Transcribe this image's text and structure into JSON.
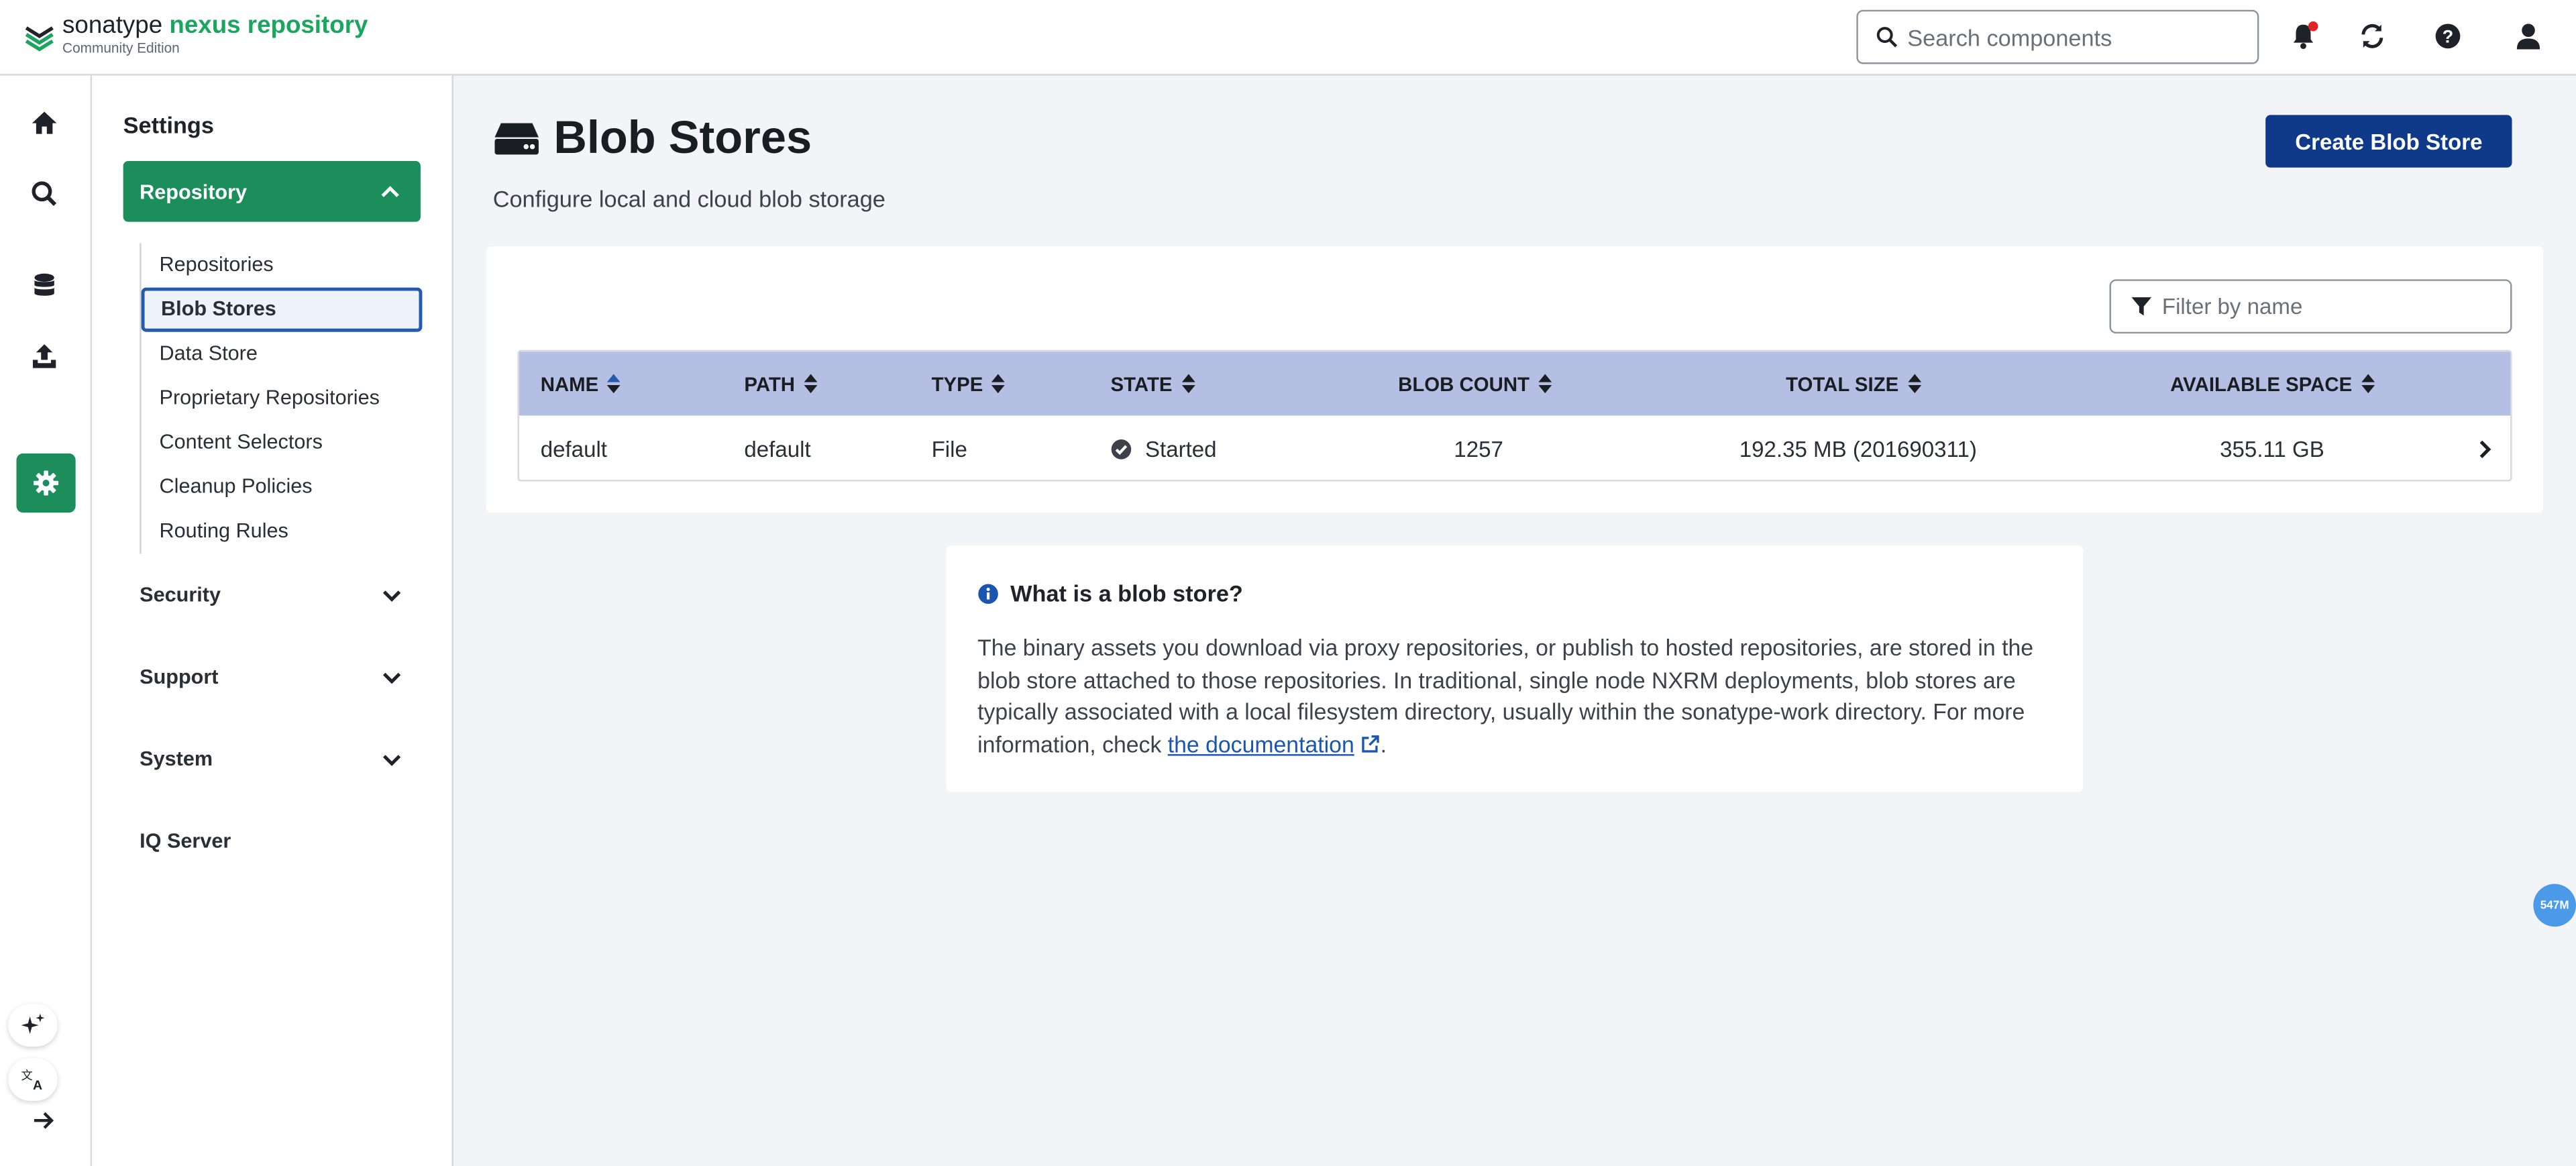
{
  "brand": {
    "name_part1": "sonatype",
    "name_part2": "nexus repository",
    "edition": "Community Edition",
    "accent_color": "#1ba65f"
  },
  "header": {
    "search": {
      "placeholder": "Search components",
      "value": ""
    },
    "icons": [
      "bell-icon",
      "refresh-icon",
      "help-icon",
      "user-icon"
    ]
  },
  "rail": {
    "items": [
      "home-icon",
      "search-icon",
      "database-icon",
      "upload-icon",
      "gear-icon"
    ],
    "active": "gear-icon",
    "bottom": [
      "sparkle-icon",
      "translate-icon",
      "arrow-right-icon"
    ]
  },
  "sidebar": {
    "title": "Settings",
    "active_group": "Repository",
    "sub_items": [
      {
        "label": "Repositories"
      },
      {
        "label": "Blob Stores",
        "active": true
      },
      {
        "label": "Data Store"
      },
      {
        "label": "Proprietary Repositories"
      },
      {
        "label": "Content Selectors"
      },
      {
        "label": "Cleanup Policies"
      },
      {
        "label": "Routing Rules"
      }
    ],
    "groups": [
      {
        "label": "Security",
        "expandable": true
      },
      {
        "label": "Support",
        "expandable": true
      },
      {
        "label": "System",
        "expandable": true
      },
      {
        "label": "IQ Server",
        "expandable": false
      }
    ]
  },
  "main": {
    "title": "Blob Stores",
    "subtitle": "Configure local and cloud blob storage",
    "create_button": "Create Blob Store",
    "filter_placeholder": "Filter by name",
    "columns": [
      "NAME",
      "PATH",
      "TYPE",
      "STATE",
      "BLOB COUNT",
      "TOTAL SIZE",
      "AVAILABLE SPACE"
    ],
    "rows": [
      {
        "name": "default",
        "path": "default",
        "type": "File",
        "state": "Started",
        "blob_count": "1257",
        "total_size": "192.35 MB (201690311)",
        "available_space": "355.11 GB"
      }
    ]
  },
  "info": {
    "title": "What is a blob store?",
    "body": "The binary assets you download via proxy repositories, or publish to hosted repositories, are stored in the blob store attached to those repositories. In traditional, single node NXRM deployments, blob stores are typically associated with a local filesystem directory, usually within the sonatype-work directory. For more information, check ",
    "link_text": "the documentation",
    "suffix": "."
  },
  "memory_badge": "547M",
  "colors": {
    "primary_green": "#1b8e5c",
    "primary_blue": "#0f3a8a",
    "table_header": "#b4bfe3",
    "link": "#1a56b0"
  }
}
